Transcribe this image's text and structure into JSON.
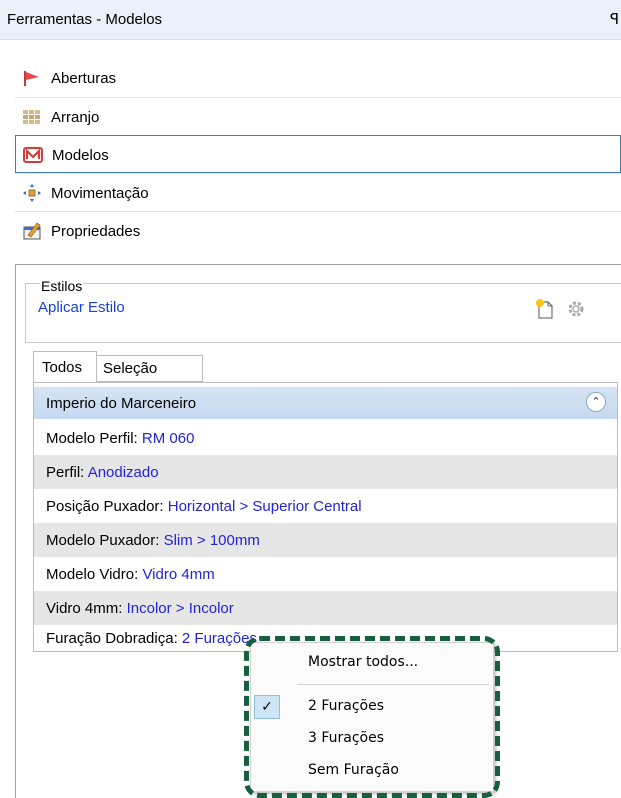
{
  "window": {
    "title": "Ferramentas - Modelos",
    "pin_glyph": "ꟼ"
  },
  "nav": {
    "items": [
      {
        "label": "Aberturas",
        "icon": "flag-icon"
      },
      {
        "label": "Arranjo",
        "icon": "grid-icon"
      },
      {
        "label": "Modelos",
        "icon": "models-icon",
        "selected": true
      },
      {
        "label": "Movimentação",
        "icon": "move-icon"
      },
      {
        "label": "Propriedades",
        "icon": "properties-icon"
      }
    ]
  },
  "estilos": {
    "legend": "Estilos",
    "apply_label": "Aplicar Estilo"
  },
  "tabs": [
    {
      "label": "Todos"
    },
    {
      "label": "Seleção"
    }
  ],
  "grid": {
    "header": "Imperio do Marceneiro",
    "rows": [
      {
        "key": "Modelo Perfil:",
        "value": "RM 060"
      },
      {
        "key": "Perfil:",
        "value": "Anodizado"
      },
      {
        "key": "Posição Puxador:",
        "value": "Horizontal > Superior Central"
      },
      {
        "key": "Modelo Puxador:",
        "value": "Slim > 100mm"
      },
      {
        "key": "Modelo Vidro:",
        "value": "Vidro 4mm"
      },
      {
        "key": "Vidro 4mm:",
        "value": "Incolor > Incolor"
      },
      {
        "key": "Furação Dobradiça:",
        "value": "2 Furações"
      }
    ]
  },
  "context_menu": {
    "items": [
      "Mostrar todos...",
      "2 Furações",
      "3 Furações",
      "Sem Furação"
    ],
    "checked": "2 Furações"
  },
  "colors": {
    "accent": "#3c7fb1",
    "link": "#1a3fd9",
    "value": "#2323d9",
    "highlight": "#17603f"
  }
}
